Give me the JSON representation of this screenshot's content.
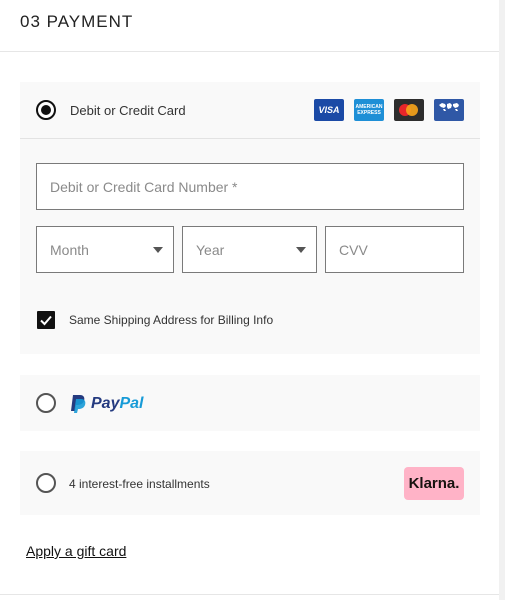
{
  "section": {
    "title": "03 PAYMENT"
  },
  "card_option": {
    "label": "Debit or Credit Card",
    "selected": true,
    "brands": [
      {
        "name": "visa-logo",
        "text": "VISA",
        "color": "#1b4aa6"
      },
      {
        "name": "amex-logo",
        "text": "AMERICAN EXPRESS",
        "color": "#1e8fd6"
      },
      {
        "name": "mastercard-logo",
        "text": "",
        "color": "#2d2d2d"
      },
      {
        "name": "diners-club-logo",
        "text": "",
        "color": "#2f58a6"
      }
    ],
    "fields": {
      "number_placeholder": "Debit or Credit Card Number *",
      "month_placeholder": "Month",
      "year_placeholder": "Year",
      "cvv_placeholder": "CVV"
    },
    "billing_checkbox": {
      "label": "Same Shipping Address for Billing Info",
      "checked": true
    }
  },
  "paypal_option": {
    "pay": "Pay",
    "pal": "Pal",
    "selected": false,
    "colors": {
      "pay": "#253b80",
      "pal": "#179bd7"
    }
  },
  "klarna_option": {
    "label": "4 interest-free installments",
    "badge": "Klarna.",
    "selected": false,
    "badge_color": "#ffb3c7"
  },
  "gift_card_link": "Apply a gift card"
}
